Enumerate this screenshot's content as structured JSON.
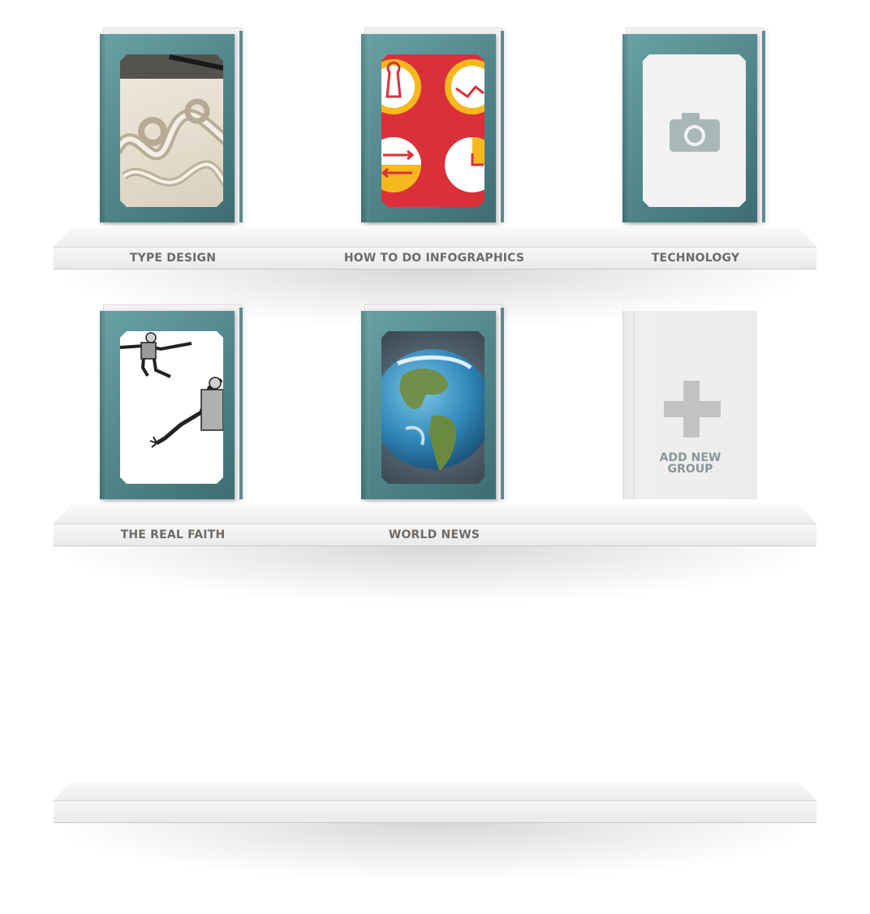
{
  "shelves": [
    {
      "books": [
        {
          "label": "TYPE DESIGN",
          "image": "lettering-sketch"
        },
        {
          "label": "HOW TO DO INFOGRAPHICS",
          "image": "infographic-icons"
        },
        {
          "label": "TECHNOLOGY",
          "image": "camera-placeholder"
        }
      ]
    },
    {
      "books": [
        {
          "label": "THE REAL FAITH",
          "image": "engraving-figures"
        },
        {
          "label": "WORLD NEWS",
          "image": "earth-globe"
        }
      ],
      "add_new": {
        "line1": "ADD NEW",
        "line2": "GROUP",
        "icon": "plus-icon"
      }
    },
    {
      "books": []
    }
  ],
  "colors": {
    "cover": "#4f8589",
    "infographic_red": "#d9303a",
    "infographic_yellow": "#f5b81e",
    "label": "#6f6a66"
  }
}
